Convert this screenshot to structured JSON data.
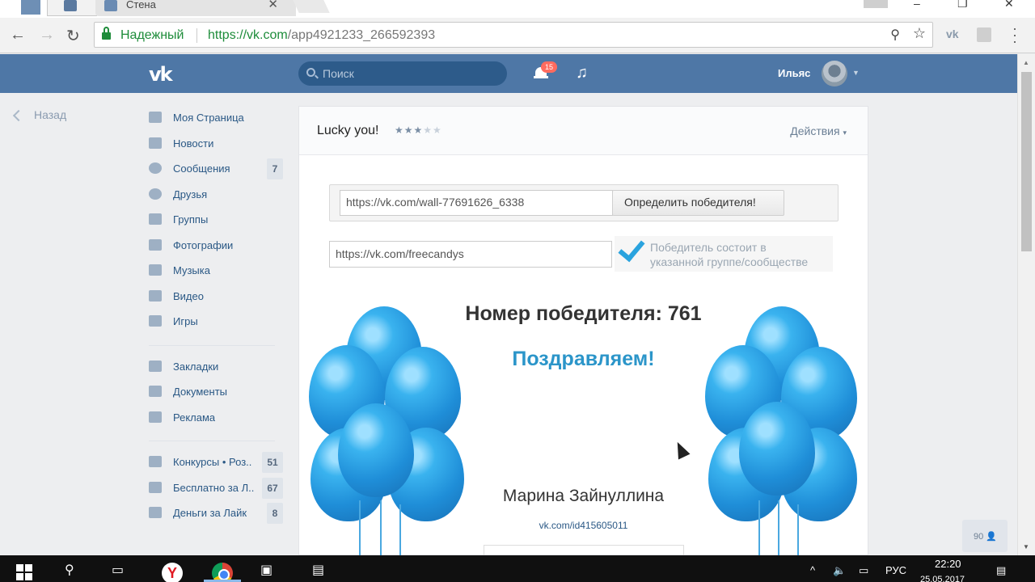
{
  "browser": {
    "tab_title": "Стена",
    "secure_label": "Надежный",
    "url_scheme": "https://",
    "url_domain": "vk.com",
    "url_path": "/app4921233_266592393"
  },
  "vk_header": {
    "logo": "vk",
    "search_placeholder": "Поиск",
    "notifications_count": "15",
    "user_name": "Ильяс"
  },
  "back_label": "Назад",
  "sidebar": {
    "items": [
      {
        "label": "Моя Страница",
        "icon": "home-icon"
      },
      {
        "label": "Новости",
        "icon": "news-icon"
      },
      {
        "label": "Сообщения",
        "icon": "messages-icon",
        "count": "7"
      },
      {
        "label": "Друзья",
        "icon": "friends-icon"
      },
      {
        "label": "Группы",
        "icon": "groups-icon"
      },
      {
        "label": "Фотографии",
        "icon": "camera-icon"
      },
      {
        "label": "Музыка",
        "icon": "music-icon"
      },
      {
        "label": "Видео",
        "icon": "video-icon"
      },
      {
        "label": "Игры",
        "icon": "gamepad-icon"
      }
    ],
    "items2": [
      {
        "label": "Закладки",
        "icon": "star-icon"
      },
      {
        "label": "Документы",
        "icon": "document-icon"
      },
      {
        "label": "Реклама",
        "icon": "megaphone-icon"
      }
    ],
    "groups": [
      {
        "label": "Конкурсы • Роз..",
        "count": "51"
      },
      {
        "label": "Бесплатно за Л..",
        "count": "67"
      },
      {
        "label": "Деньги за Лайк",
        "count": "8"
      }
    ]
  },
  "app": {
    "title": "Lucky you!",
    "rating": "3.5",
    "actions_label": "Действия",
    "post_url_value": "https://vk.com/wall-77691626_6338",
    "determine_button": "Определить победителя!",
    "group_url_value": "https://vk.com/freecandys",
    "check_text_line1": "Победитель состоит в",
    "check_text_line2": "указанной группе/сообществе",
    "winner_number_text": "Номер победителя: 761",
    "congrats_text": "Поздравляем!",
    "winner_name": "Марина Зайнуллина",
    "winner_link": "vk.com/id415605011"
  },
  "online_count": "90",
  "taskbar": {
    "lang": "РУС",
    "time": "22:20",
    "date": "25.05.2017"
  },
  "colors": {
    "vk_blue": "#4e77a6",
    "link": "#2a5885",
    "congrats": "#2b95c9",
    "secure_green": "#1e8c3a"
  }
}
